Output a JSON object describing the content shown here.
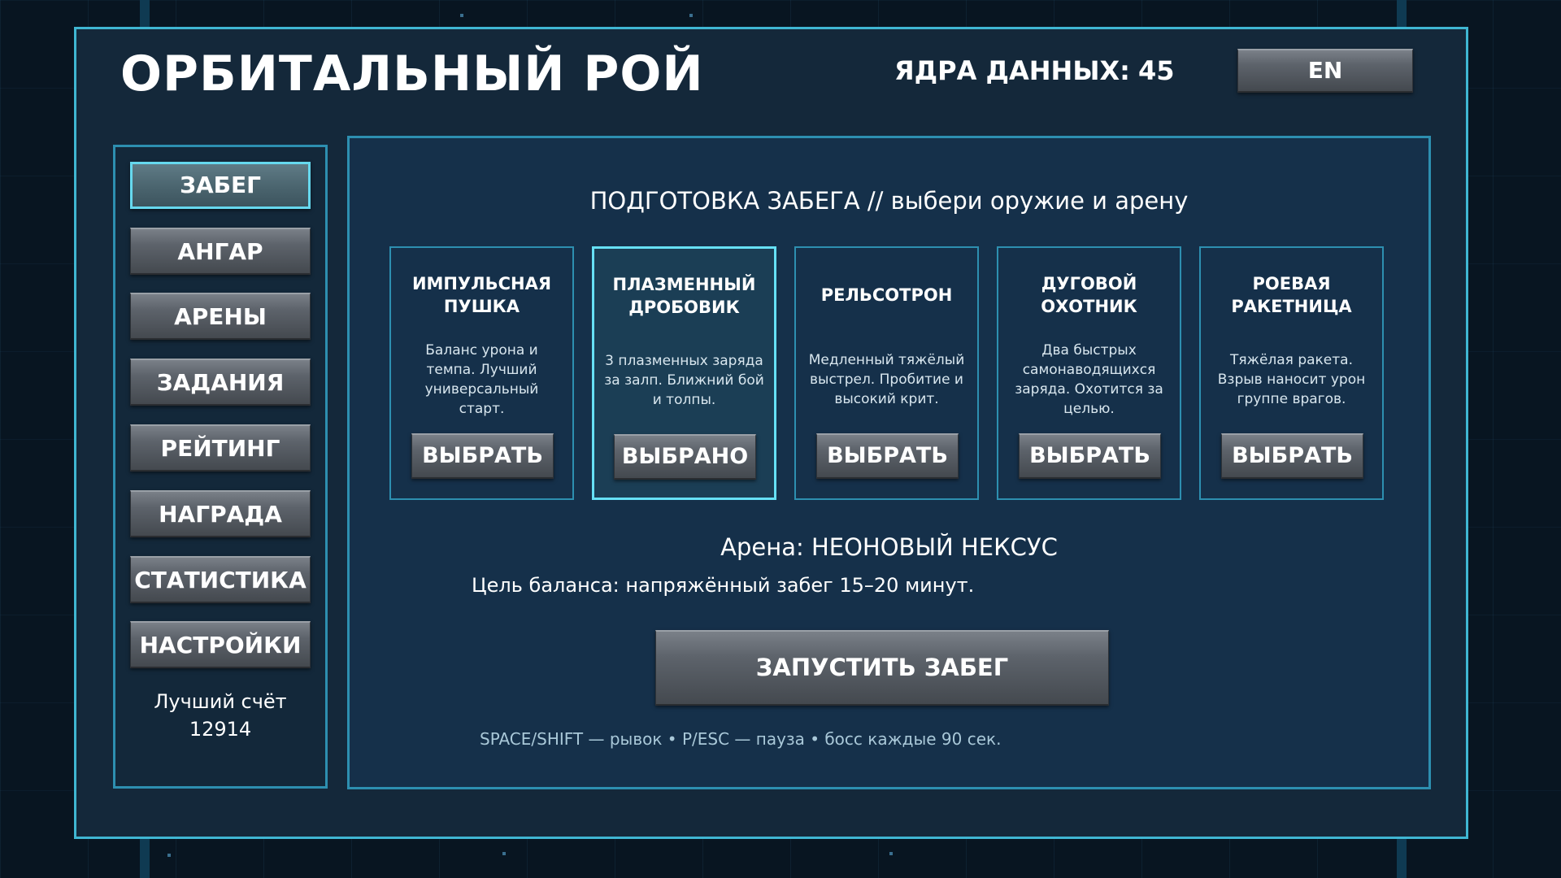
{
  "header": {
    "title": "ОРБИТАЛЬНЫЙ РОЙ",
    "cores_label": "ЯДРА ДАННЫХ:",
    "cores_value": "45",
    "lang_button": "EN"
  },
  "sidebar": {
    "items": [
      {
        "label": "ЗАБЕГ",
        "active": true
      },
      {
        "label": "АНГАР",
        "active": false
      },
      {
        "label": "АРЕНЫ",
        "active": false
      },
      {
        "label": "ЗАДАНИЯ",
        "active": false
      },
      {
        "label": "РЕЙТИНГ",
        "active": false
      },
      {
        "label": "НАГРАДА",
        "active": false
      },
      {
        "label": "СТАТИСТИКА",
        "active": false
      },
      {
        "label": "НАСТРОЙКИ",
        "active": false
      }
    ],
    "best_score_label": "Лучший счёт",
    "best_score_value": "12914"
  },
  "main": {
    "title": "ПОДГОТОВКА ЗАБЕГА // выбери оружие и арену",
    "weapons": [
      {
        "name": "ИМПУЛЬСНАЯ\nПУШКА",
        "description": "Баланс урона и темпа. Лучший универсальный старт.",
        "button": "ВЫБРАТЬ",
        "selected": false
      },
      {
        "name": "ПЛАЗМЕННЫЙ\nДРОБОВИК",
        "description": "3 плазменных заряда за залп. Ближний бой и толпы.",
        "button": "ВЫБРАНО",
        "selected": true
      },
      {
        "name": "РЕЛЬСОТРОН",
        "description": "Медленный тяжёлый выстрел. Пробитие и высокий крит.",
        "button": "ВЫБРАТЬ",
        "selected": false
      },
      {
        "name": "ДУГОВОЙ\nОХОТНИК",
        "description": "Два быстрых самонаводящихся заряда. Охотится за целью.",
        "button": "ВЫБРАТЬ",
        "selected": false
      },
      {
        "name": "РОЕВАЯ\nРАКЕТНИЦА",
        "description": "Тяжёлая ракета. Взрыв наносит урон группе врагов.",
        "button": "ВЫБРАТЬ",
        "selected": false
      }
    ],
    "arena_label": "Арена:",
    "arena_name": "НЕОНОВЫЙ НЕКСУС",
    "balance_goal": "Цель баланса: напряжённый забег 15–20 минут.",
    "launch_button": "ЗАПУСТИТЬ ЗАБЕГ",
    "controls_hint": "SPACE/SHIFT — рывок • P/ESC — пауза • босс каждые 90 сек."
  },
  "colors": {
    "panel_border": "#3fb6d2",
    "selected_border": "#66e0f5",
    "panel_bg": "#14283a"
  }
}
